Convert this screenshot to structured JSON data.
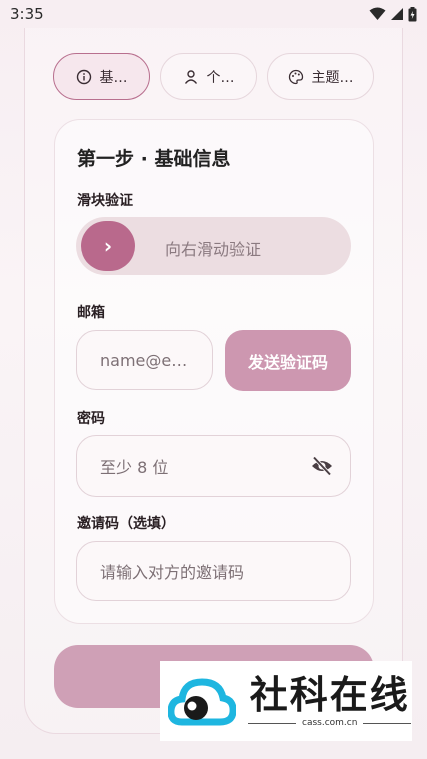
{
  "status_bar": {
    "time": "3:35"
  },
  "tabs": [
    {
      "label": "基…",
      "icon": "info-icon",
      "active": true
    },
    {
      "label": "个…",
      "icon": "person-icon",
      "active": false
    },
    {
      "label": "主题…",
      "icon": "palette-icon",
      "active": false
    }
  ],
  "form": {
    "step_title": "第一步 · 基础信息",
    "slider": {
      "label": "滑块验证",
      "hint": "向右滑动验证",
      "knob_glyph": "›"
    },
    "email": {
      "label": "邮箱",
      "placeholder": "name@e…",
      "send_label": "发送验证码"
    },
    "password": {
      "label": "密码",
      "placeholder": "至少 8 位"
    },
    "invite": {
      "label": "邀请码（选填）",
      "placeholder": "请输入对方的邀请码"
    }
  },
  "watermark": {
    "title": "社科在线",
    "subtitle": "cass.com.cn"
  },
  "colors": {
    "accent": "#b9698c",
    "button": "#cd97b0",
    "submit": "#cfa0b6"
  }
}
